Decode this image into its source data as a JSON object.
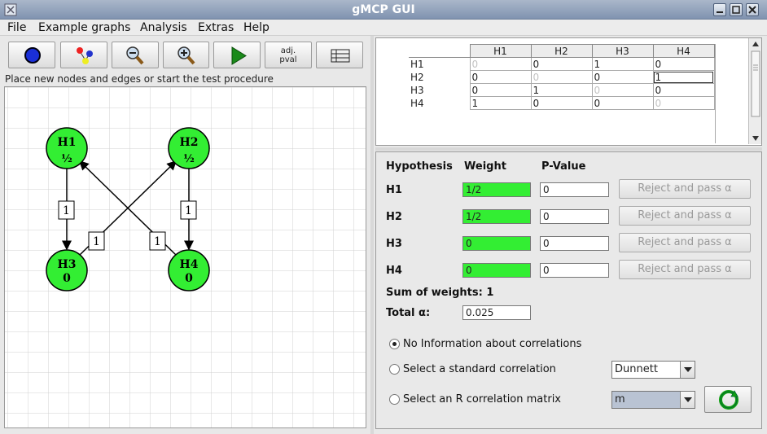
{
  "window": {
    "title": "gMCP GUI"
  },
  "menu": [
    "File",
    "Example graphs",
    "Analysis",
    "Extras",
    "Help"
  ],
  "toolbar": {
    "adj_pval_line1": "adj.",
    "adj_pval_line2": "pval"
  },
  "hint": "Place new nodes and edges or start the test procedure",
  "graph": {
    "nodes": [
      {
        "name": "H1",
        "weight": "½"
      },
      {
        "name": "H2",
        "weight": "½"
      },
      {
        "name": "H3",
        "weight": "0"
      },
      {
        "name": "H4",
        "weight": "0"
      }
    ],
    "edge_labels": [
      "1",
      "1",
      "1",
      "1"
    ]
  },
  "matrix": {
    "headers": [
      "H1",
      "H2",
      "H3",
      "H4"
    ],
    "rows": [
      {
        "label": "H1",
        "cells": [
          "0",
          "0",
          "1",
          "0"
        ]
      },
      {
        "label": "H2",
        "cells": [
          "0",
          "0",
          "0",
          "1"
        ]
      },
      {
        "label": "H3",
        "cells": [
          "0",
          "1",
          "0",
          "0"
        ]
      },
      {
        "label": "H4",
        "cells": [
          "1",
          "0",
          "0",
          "0"
        ]
      }
    ]
  },
  "hypotheses": {
    "col_hypothesis": "Hypothesis",
    "col_weight": "Weight",
    "col_pvalue": "P-Value",
    "rows": [
      {
        "name": "H1",
        "weight": "1/2",
        "pvalue": "0",
        "button": "Reject and pass α"
      },
      {
        "name": "H2",
        "weight": "1/2",
        "pvalue": "0",
        "button": "Reject and pass α"
      },
      {
        "name": "H3",
        "weight": "0",
        "pvalue": "0",
        "button": "Reject and pass α"
      },
      {
        "name": "H4",
        "weight": "0",
        "pvalue": "0",
        "button": "Reject and pass α"
      }
    ],
    "sum_of_weights": "Sum of weights: 1",
    "total_alpha_label": "Total α:",
    "total_alpha_value": "0.025"
  },
  "correlation": {
    "opt_none": "No Information about correlations",
    "opt_standard": "Select a standard correlation",
    "opt_matrix": "Select an R correlation matrix",
    "standard_value": "Dunnett",
    "matrix_value": "m"
  },
  "colors": {
    "node_fill": "#33ee33",
    "titlebar": "#8a9bb6"
  }
}
